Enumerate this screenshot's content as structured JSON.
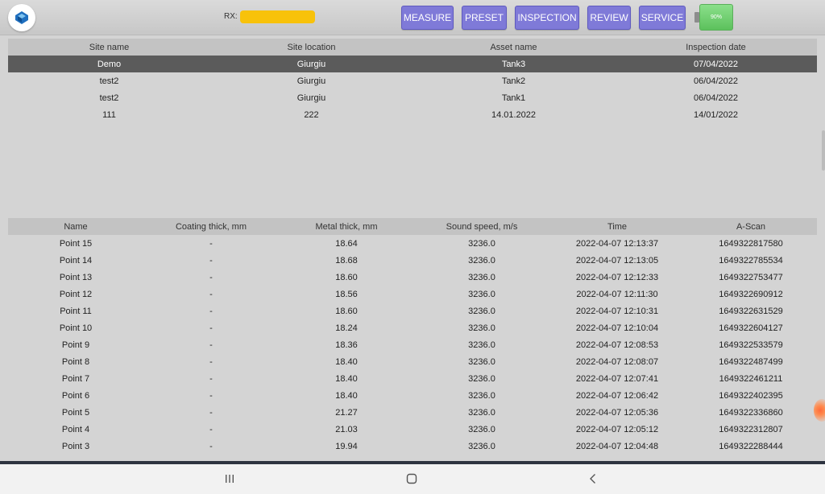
{
  "header": {
    "rx_label": "RX:",
    "nav": [
      "MEASURE",
      "PRESET",
      "INSPECTION",
      "REVIEW",
      "SERVICE"
    ],
    "battery_text": "90%",
    "colors": {
      "button": "#7f7ad8",
      "rx_bar": "#f8c20a",
      "battery": "#6fd16f"
    }
  },
  "sites": {
    "columns": [
      "Site name",
      "Site location",
      "Asset name",
      "Inspection date"
    ],
    "rows": [
      [
        "Demo",
        "Giurgiu",
        "Tank3",
        "07/04/2022"
      ],
      [
        "test2",
        "Giurgiu",
        "Tank2",
        "06/04/2022"
      ],
      [
        "test2",
        "Giurgiu",
        "Tank1",
        "06/04/2022"
      ],
      [
        "111",
        "222",
        "14.01.2022",
        "14/01/2022"
      ]
    ]
  },
  "points": {
    "columns": [
      "Name",
      "Coating thick, mm",
      "Metal thick, mm",
      "Sound speed, m/s",
      "Time",
      "A-Scan"
    ],
    "rows": [
      [
        "Point 15",
        "-",
        "18.64",
        "3236.0",
        "2022-04-07 12:13:37",
        "1649322817580"
      ],
      [
        "Point 14",
        "-",
        "18.68",
        "3236.0",
        "2022-04-07 12:13:05",
        "1649322785534"
      ],
      [
        "Point 13",
        "-",
        "18.60",
        "3236.0",
        "2022-04-07 12:12:33",
        "1649322753477"
      ],
      [
        "Point 12",
        "-",
        "18.56",
        "3236.0",
        "2022-04-07 12:11:30",
        "1649322690912"
      ],
      [
        "Point 11",
        "-",
        "18.60",
        "3236.0",
        "2022-04-07 12:10:31",
        "1649322631529"
      ],
      [
        "Point 10",
        "-",
        "18.24",
        "3236.0",
        "2022-04-07 12:10:04",
        "1649322604127"
      ],
      [
        "Point 9",
        "-",
        "18.36",
        "3236.0",
        "2022-04-07 12:08:53",
        "1649322533579"
      ],
      [
        "Point 8",
        "-",
        "18.40",
        "3236.0",
        "2022-04-07 12:08:07",
        "1649322487499"
      ],
      [
        "Point 7",
        "-",
        "18.40",
        "3236.0",
        "2022-04-07 12:07:41",
        "1649322461211"
      ],
      [
        "Point 6",
        "-",
        "18.40",
        "3236.0",
        "2022-04-07 12:06:42",
        "1649322402395"
      ],
      [
        "Point 5",
        "-",
        "21.27",
        "3236.0",
        "2022-04-07 12:05:36",
        "1649322336860"
      ],
      [
        "Point 4",
        "-",
        "21.03",
        "3236.0",
        "2022-04-07 12:05:12",
        "1649322312807"
      ],
      [
        "Point 3",
        "-",
        "19.94",
        "3236.0",
        "2022-04-07 12:04:48",
        "1649322288444"
      ]
    ]
  }
}
